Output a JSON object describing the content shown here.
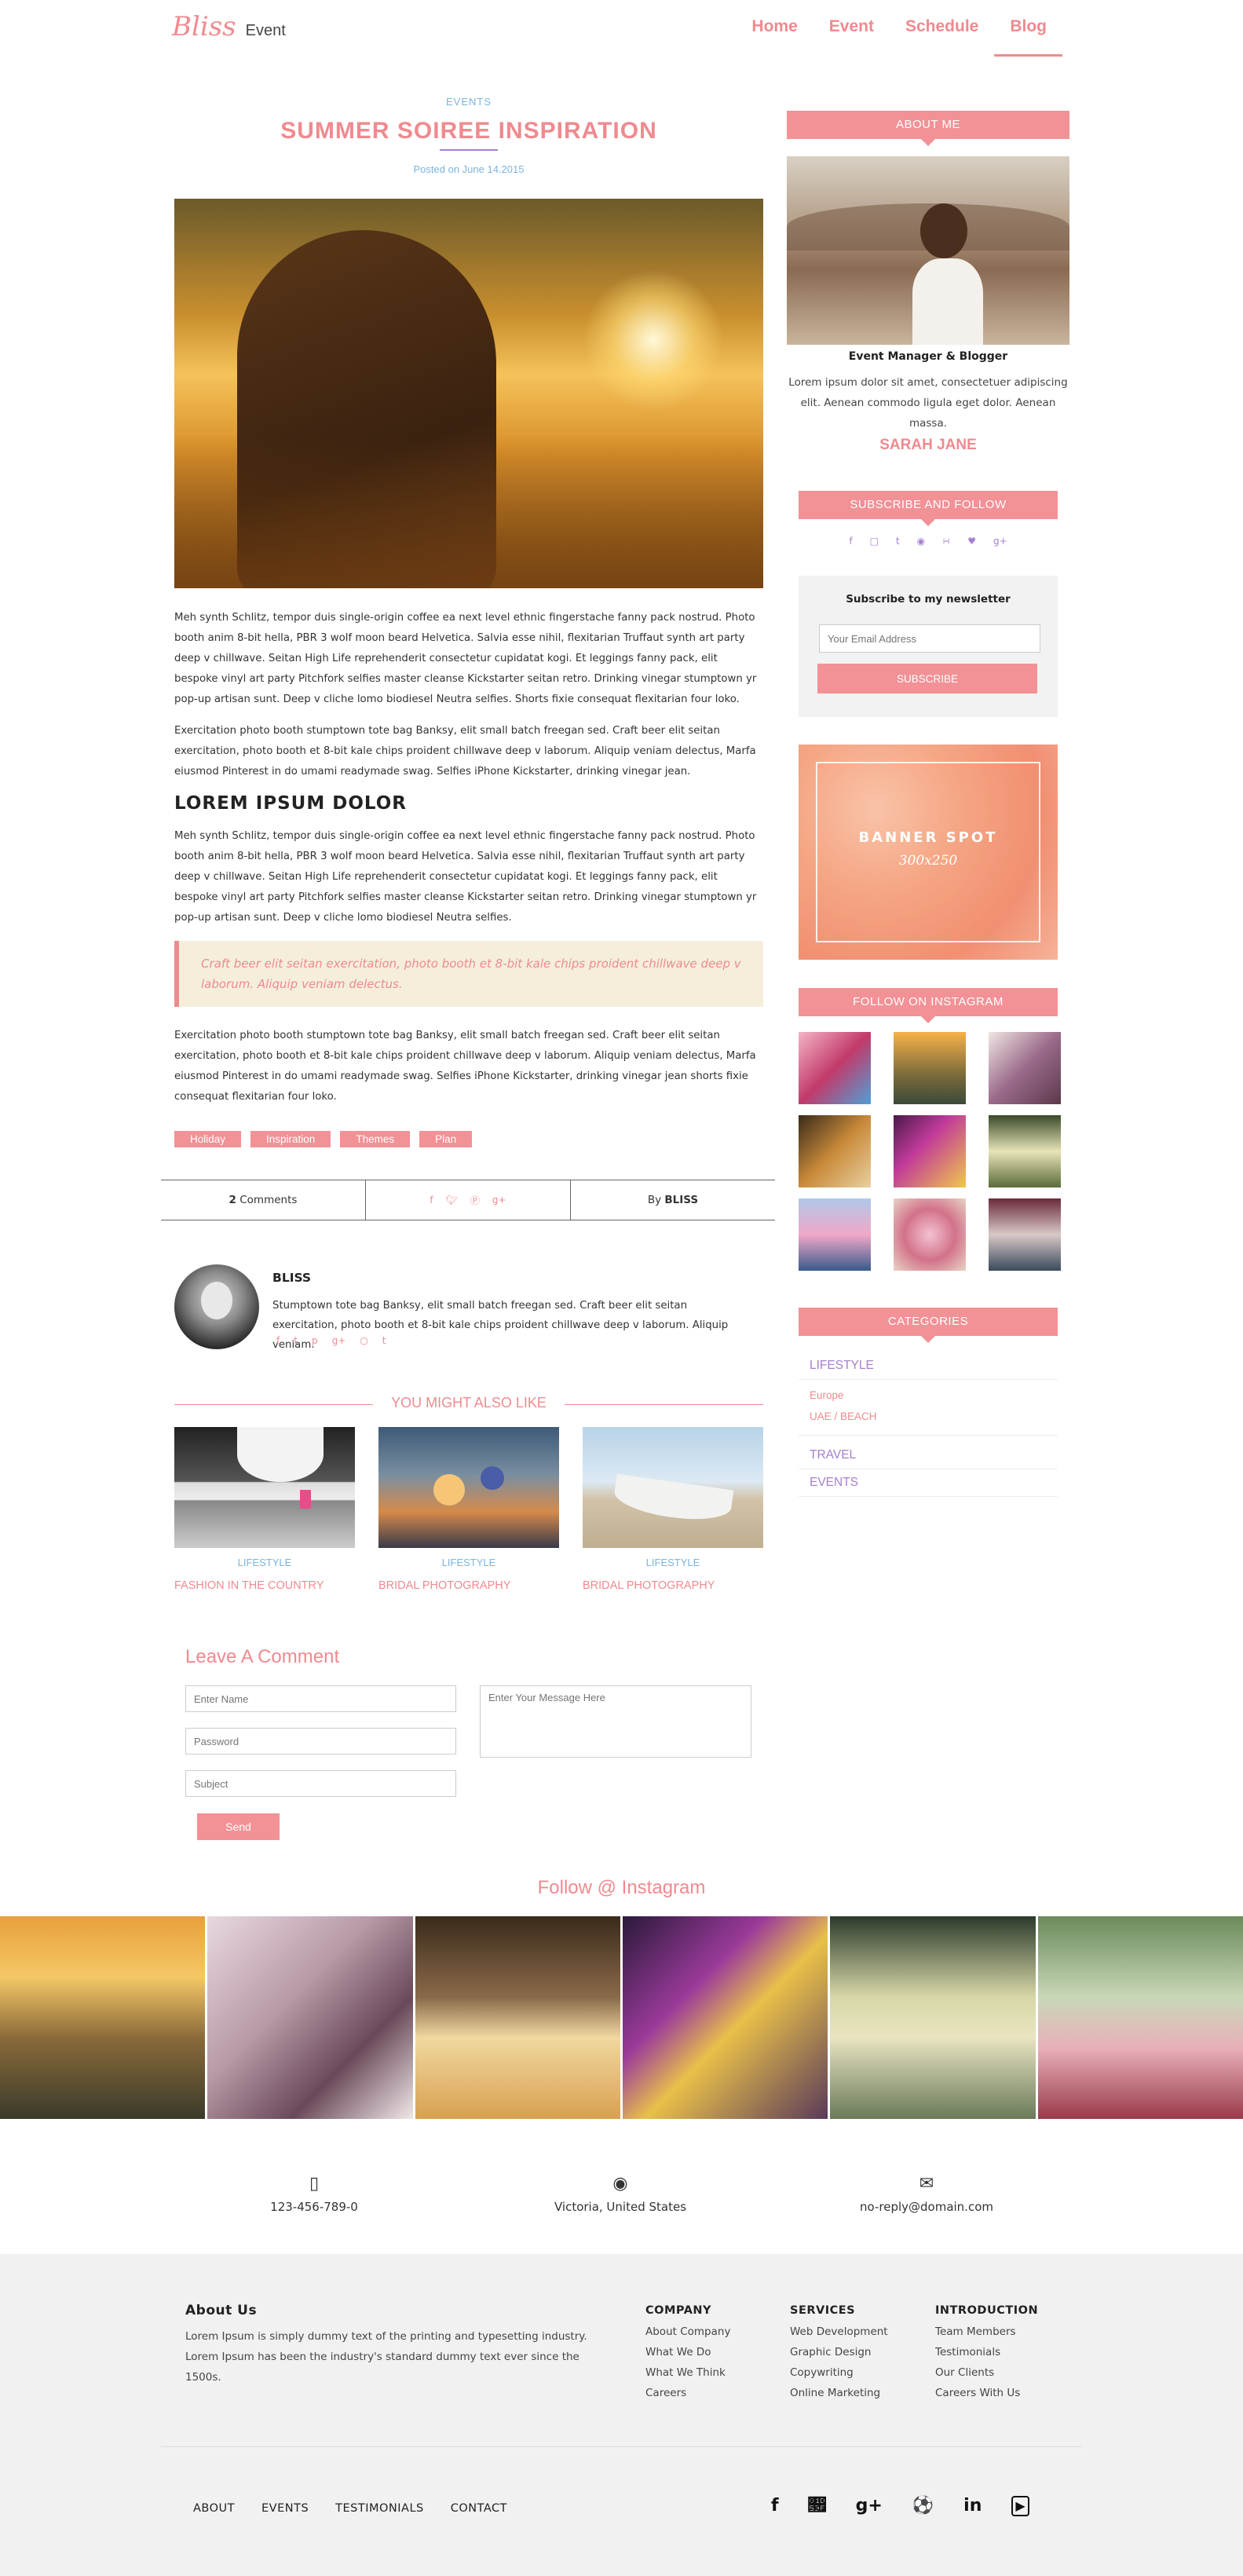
{
  "header": {
    "logo_script": "Bliss",
    "logo_text": "Event",
    "nav": [
      "Home",
      "Event",
      "Schedule",
      "Blog"
    ],
    "active_nav": "Blog"
  },
  "post": {
    "category": "EVENTS",
    "title": "SUMMER SOIREE INSPIRATION",
    "date": "Posted on June 14.2015",
    "paragraphs": [
      "Meh synth Schlitz, tempor duis single-origin coffee ea next level ethnic fingerstache fanny pack nostrud. Photo booth anim 8-bit hella, PBR 3 wolf moon beard Helvetica. Salvia esse nihil, flexitarian Truffaut synth art party deep v chillwave. Seitan High Life reprehenderit consectetur cupidatat kogi. Et leggings fanny pack, elit bespoke vinyl art party Pitchfork selfies master cleanse Kickstarter seitan retro. Drinking vinegar stumptown yr pop-up artisan sunt. Deep v cliche lomo biodiesel Neutra selfies. Shorts fixie consequat flexitarian four loko.",
      "Exercitation photo booth stumptown tote bag Banksy, elit small batch freegan sed. Craft beer elit seitan exercitation, photo booth et 8-bit kale chips proident chillwave deep v laborum. Aliquip veniam delectus, Marfa eiusmod Pinterest in do umami readymade swag. Selfies iPhone Kickstarter, drinking vinegar jean.",
      "Meh synth Schlitz, tempor duis single-origin coffee ea next level ethnic fingerstache fanny pack nostrud. Photo booth anim 8-bit hella, PBR 3 wolf moon beard Helvetica. Salvia esse nihil, flexitarian Truffaut synth art party deep v chillwave. Seitan High Life reprehenderit consectetur cupidatat kogi. Et leggings fanny pack, elit bespoke vinyl art party Pitchfork selfies master cleanse Kickstarter seitan retro. Drinking vinegar stumptown yr pop-up artisan sunt. Deep v cliche lomo biodiesel Neutra selfies.",
      "Exercitation photo booth stumptown tote bag Banksy, elit small batch freegan sed. Craft beer elit seitan exercitation, photo booth et 8-bit kale chips proident chillwave deep v laborum. Aliquip veniam delectus, Marfa eiusmod Pinterest in do umami readymade swag. Selfies iPhone Kickstarter, drinking vinegar jean shorts fixie consequat flexitarian four loko."
    ],
    "subheading": "LOREM IPSUM DOLOR",
    "quote": "Craft beer elit seitan exercitation, photo booth et 8-bit kale chips proident chillwave deep v laborum. Aliquip veniam delectus.",
    "tags": [
      "Holiday",
      "Inspiration",
      "Themes",
      "Plan"
    ],
    "comments_count": "2",
    "comments_label": "Comments",
    "by_label": "By",
    "author": "BLISS"
  },
  "author_box": {
    "name": "BLISS",
    "bio": "Stumptown tote bag Banksy, elit small batch freegan sed. Craft beer elit seitan exercitation, photo booth et 8-bit kale chips proident chillwave deep v laborum. Aliquip veniam."
  },
  "related": {
    "heading": "YOU MIGHT ALSO LIKE",
    "items": [
      {
        "category": "LIFESTYLE",
        "title": "FASHION IN THE COUNTRY"
      },
      {
        "category": "LIFESTYLE",
        "title": "BRIDAL PHOTOGRAPHY"
      },
      {
        "category": "LIFESTYLE",
        "title": "BRIDAL PHOTOGRAPHY"
      }
    ]
  },
  "comment_form": {
    "heading": "Leave A Comment",
    "name_placeholder": "Enter Name",
    "password_placeholder": "Password",
    "subject_placeholder": "Subject",
    "message_placeholder": "Enter Your Message Here",
    "send_label": "Send"
  },
  "sidebar": {
    "about_heading": "ABOUT ME",
    "about_role": "Event Manager & Blogger",
    "about_text": "Lorem ipsum dolor sit amet, consectetuer adipiscing elit. Aenean commodo ligula eget dolor. Aenean massa.",
    "about_name": "SARAH JANE",
    "subscribe_heading": "SUBSCRIBE AND FOLLOW",
    "newsletter_label": "Subscribe to my newsletter",
    "email_placeholder": "Your Email Address",
    "subscribe_button": "SUBSCRIBE",
    "banner_title": "BANNER SPOT",
    "banner_size": "300x250",
    "instagram_heading": "FOLLOW ON INSTAGRAM",
    "categories_heading": "CATEGORIES",
    "categories": {
      "lifestyle": "LIFESTYLE",
      "sub": [
        "Europe",
        "UAE / BEACH"
      ],
      "travel": "TRAVEL",
      "events": "EVENTS"
    }
  },
  "instagram_strip": {
    "heading": "Follow @ Instagram"
  },
  "contact": {
    "phone": "123-456-789-0",
    "location": "Victoria, United States",
    "email": "no-reply@domain.com"
  },
  "footer": {
    "about_heading": "About Us",
    "about_text": "Lorem Ipsum is simply dummy text of the printing and typesetting industry. Lorem Ipsum has been the industry's standard dummy text ever since the 1500s.",
    "columns": [
      {
        "heading": "COMPANY",
        "links": [
          "About Company",
          "What We Do",
          "What We Think",
          "Careers"
        ]
      },
      {
        "heading": "SERVICES",
        "links": [
          "Web Development",
          "Graphic Design",
          "Copywriting",
          "Online Marketing"
        ]
      },
      {
        "heading": "INTRODUCTION",
        "links": [
          "Team Members",
          "Testimonials",
          "Our Clients",
          "Careers With Us"
        ]
      }
    ],
    "bottom_nav": [
      "ABOUT",
      "EVENTS",
      "TESTIMONIALS",
      "CONTACT"
    ],
    "social_icons": [
      "facebook-icon",
      "twitter-icon",
      "google-plus-icon",
      "dribbble-icon",
      "linkedin-icon",
      "youtube-icon"
    ]
  },
  "colors": {
    "accent": "#f29196",
    "link_blue": "#7ab4e0",
    "purple": "#a67fcf",
    "quote_bg": "#f5eedb"
  }
}
